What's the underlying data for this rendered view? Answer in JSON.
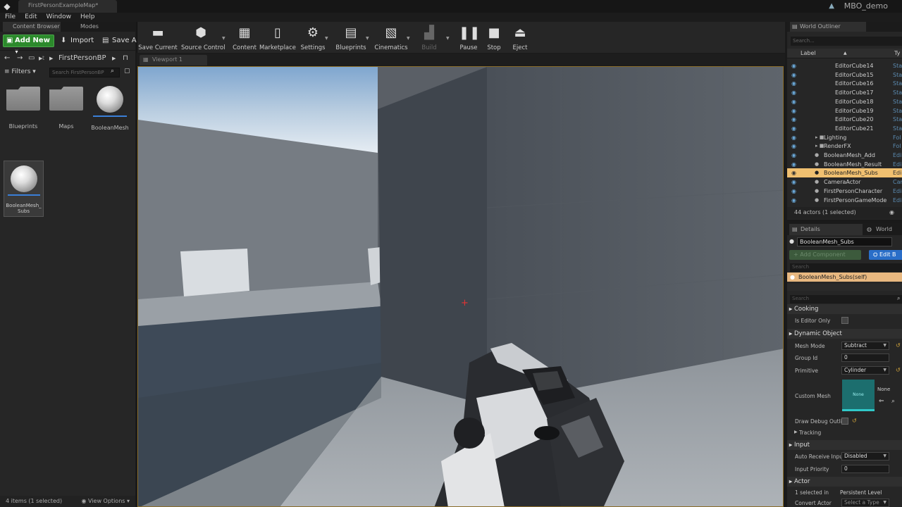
{
  "title_bar": {
    "doc_tab": "FirstPersonExampleMap*",
    "project_name": "MBO_demo"
  },
  "menu": [
    "File",
    "Edit",
    "Window",
    "Help"
  ],
  "content_browser": {
    "tabs": [
      "Content Browser",
      "Modes"
    ],
    "add_new": "Add New",
    "import": "Import",
    "save_all": "Save A",
    "path_root": "t",
    "path_current": "FirstPersonBP",
    "filters": "Filters",
    "search_placeholder": "Search FirstPersonBP",
    "assets": [
      {
        "label": "Blueprints",
        "kind": "folder"
      },
      {
        "label": "Maps",
        "kind": "folder"
      },
      {
        "label": "BooleanMesh",
        "kind": "sphere"
      },
      {
        "label": "BooleanMesh_Subs",
        "kind": "sphere"
      }
    ],
    "status": "4 items (1 selected)",
    "view_options": "View Options"
  },
  "toolbar": [
    {
      "label": "Save Current",
      "icon": "save-icon"
    },
    {
      "label": "Source Control",
      "icon": "source-control-icon"
    },
    {
      "label": "Content",
      "icon": "content-icon"
    },
    {
      "label": "Marketplace",
      "icon": "marketplace-icon"
    },
    {
      "label": "Settings",
      "icon": "settings-icon"
    },
    {
      "label": "Blueprints",
      "icon": "blueprints-icon"
    },
    {
      "label": "Cinematics",
      "icon": "cinematics-icon"
    },
    {
      "label": "Build",
      "icon": "build-icon"
    },
    {
      "label": "Pause",
      "icon": "pause-icon"
    },
    {
      "label": "Stop",
      "icon": "stop-icon"
    },
    {
      "label": "Eject",
      "icon": "eject-icon"
    }
  ],
  "viewport": {
    "tab": "Viewport 1"
  },
  "world_outliner": {
    "tab": "World Outliner",
    "search_placeholder": "Search...",
    "col_label": "Label",
    "col_type": "Ty",
    "rows": [
      {
        "name": "EditorCube14",
        "type": "Sta"
      },
      {
        "name": "EditorCube15",
        "type": "Sta"
      },
      {
        "name": "EditorCube16",
        "type": "Sta"
      },
      {
        "name": "EditorCube17",
        "type": "Sta"
      },
      {
        "name": "EditorCube18",
        "type": "Sta"
      },
      {
        "name": "EditorCube19",
        "type": "Sta"
      },
      {
        "name": "EditorCube20",
        "type": "Sta"
      },
      {
        "name": "EditorCube21",
        "type": "Sta"
      },
      {
        "name": "Lighting",
        "type": "Fol"
      },
      {
        "name": "RenderFX",
        "type": "Fol"
      },
      {
        "name": "BooleanMesh_Add",
        "type": "Edi"
      },
      {
        "name": "BooleanMesh_Result",
        "type": "Edi"
      },
      {
        "name": "BooleanMesh_Subs",
        "type": "Edi"
      },
      {
        "name": "CameraActor",
        "type": "Cam"
      },
      {
        "name": "FirstPersonCharacter",
        "type": "Edi"
      },
      {
        "name": "FirstPersonGameMode",
        "type": "Edi"
      }
    ],
    "status": "44 actors (1 selected)"
  },
  "details": {
    "tabs": [
      "Details",
      "World Setti"
    ],
    "actor_name": "BooleanMesh_Subs",
    "add_component": "+ Add Component",
    "edit_blueprint": "Edit B",
    "search_placeholder": "Search",
    "component_self": "BooleanMesh_Subs(self)",
    "sections": {
      "cooking": "Cooking",
      "dynamic_object": "Dynamic Object",
      "tracking": "Tracking",
      "input": "Input",
      "actor": "Actor"
    },
    "props": {
      "is_editor_only": "Is Editor Only",
      "mesh_mode_label": "Mesh Mode",
      "mesh_mode_value": "Subtract",
      "group_id_label": "Group Id",
      "group_id_value": "0",
      "primitive_label": "Primitive",
      "primitive_value": "Cylinder",
      "custom_mesh_label": "Custom Mesh",
      "custom_mesh_thumb": "None",
      "custom_mesh_value": "None",
      "draw_debug_label": "Draw Debug Outli",
      "auto_receive_label": "Auto Receive Inpu",
      "auto_receive_value": "Disabled",
      "input_priority_label": "Input Priority",
      "input_priority_value": "0",
      "selected_in_label": "1 selected in",
      "selected_in_value": "Persistent Level",
      "convert_actor_label": "Convert Actor",
      "convert_actor_value": "Select a Type"
    }
  },
  "colors": {
    "accent_green": "#2c8a2c",
    "selection_highlight": "#f0c070",
    "edit_blueprint_blue": "#2a6ec8",
    "crosshair_red": "#e43333"
  }
}
